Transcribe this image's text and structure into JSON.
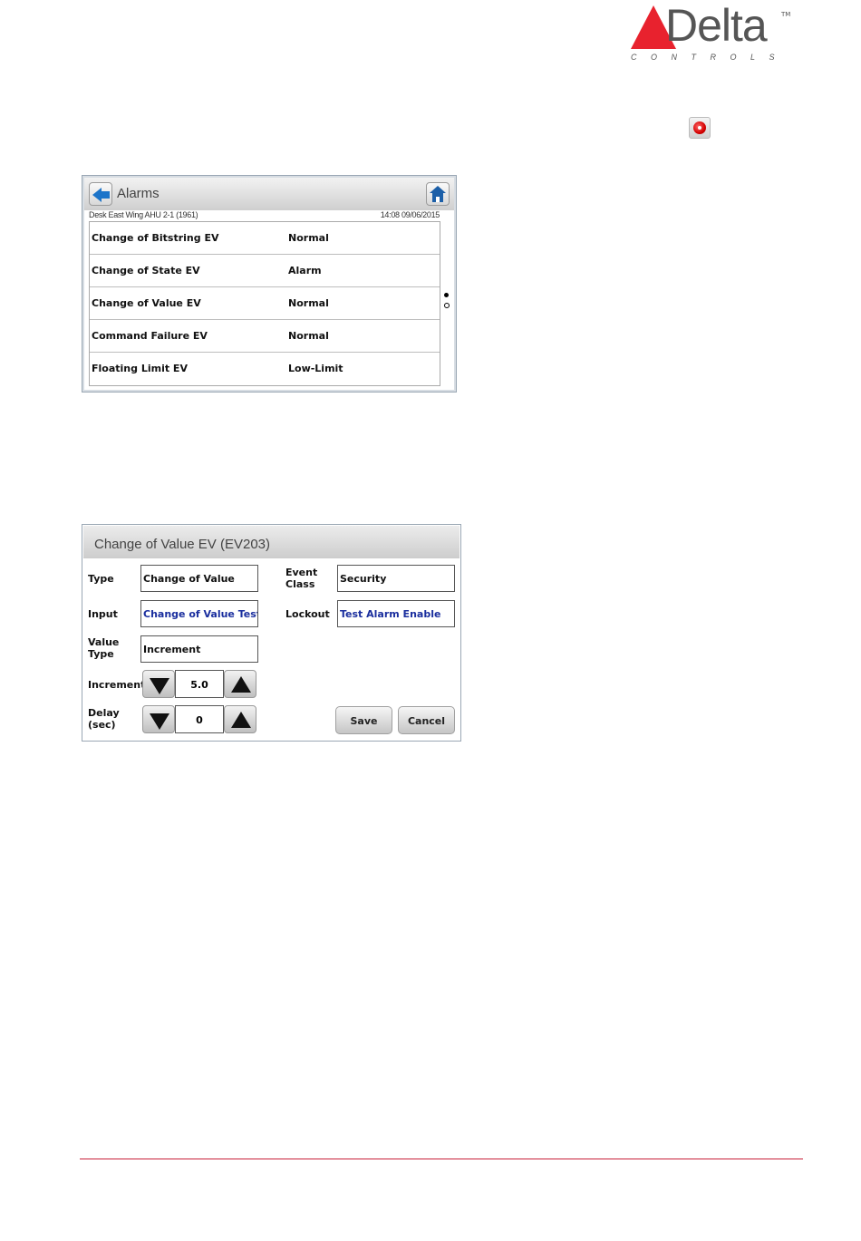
{
  "logo": {
    "word": "Delta",
    "tm": "TM",
    "sub": "CONTROLS"
  },
  "colors": {
    "brand_red": "#e8222e",
    "link_blue": "#1a2e9e",
    "footer_red": "#c8203a"
  },
  "alarms_screen": {
    "title": "Alarms",
    "device": "Desk East Wing AHU 2-1 (1961)",
    "datetime": "14:08 09/06/2015",
    "rows": [
      {
        "name": "Change of Bitstring EV",
        "state": "Normal"
      },
      {
        "name": "Change of State EV",
        "state": "Alarm"
      },
      {
        "name": "Change of Value EV",
        "state": "Normal"
      },
      {
        "name": "Command Failure EV",
        "state": "Normal"
      },
      {
        "name": "Floating Limit EV",
        "state": "Low-Limit"
      }
    ]
  },
  "event_screen": {
    "title": "Change of Value EV (EV203)",
    "type_label": "Type",
    "type_value": "Change of Value",
    "input_label": "Input",
    "input_value": "Change of Value Test A",
    "value_type_label_1": "Value",
    "value_type_label_2": "Type",
    "value_type_value": "Increment",
    "increment_label": "Increment",
    "increment_value": "5.0",
    "delay_label_1": "Delay",
    "delay_label_2": "(sec)",
    "delay_value": "0",
    "event_class_label_1": "Event",
    "event_class_label_2": "Class",
    "event_class_value": "Security",
    "lockout_label": "Lockout",
    "lockout_value": "Test Alarm Enable",
    "save_label": "Save",
    "cancel_label": "Cancel"
  }
}
